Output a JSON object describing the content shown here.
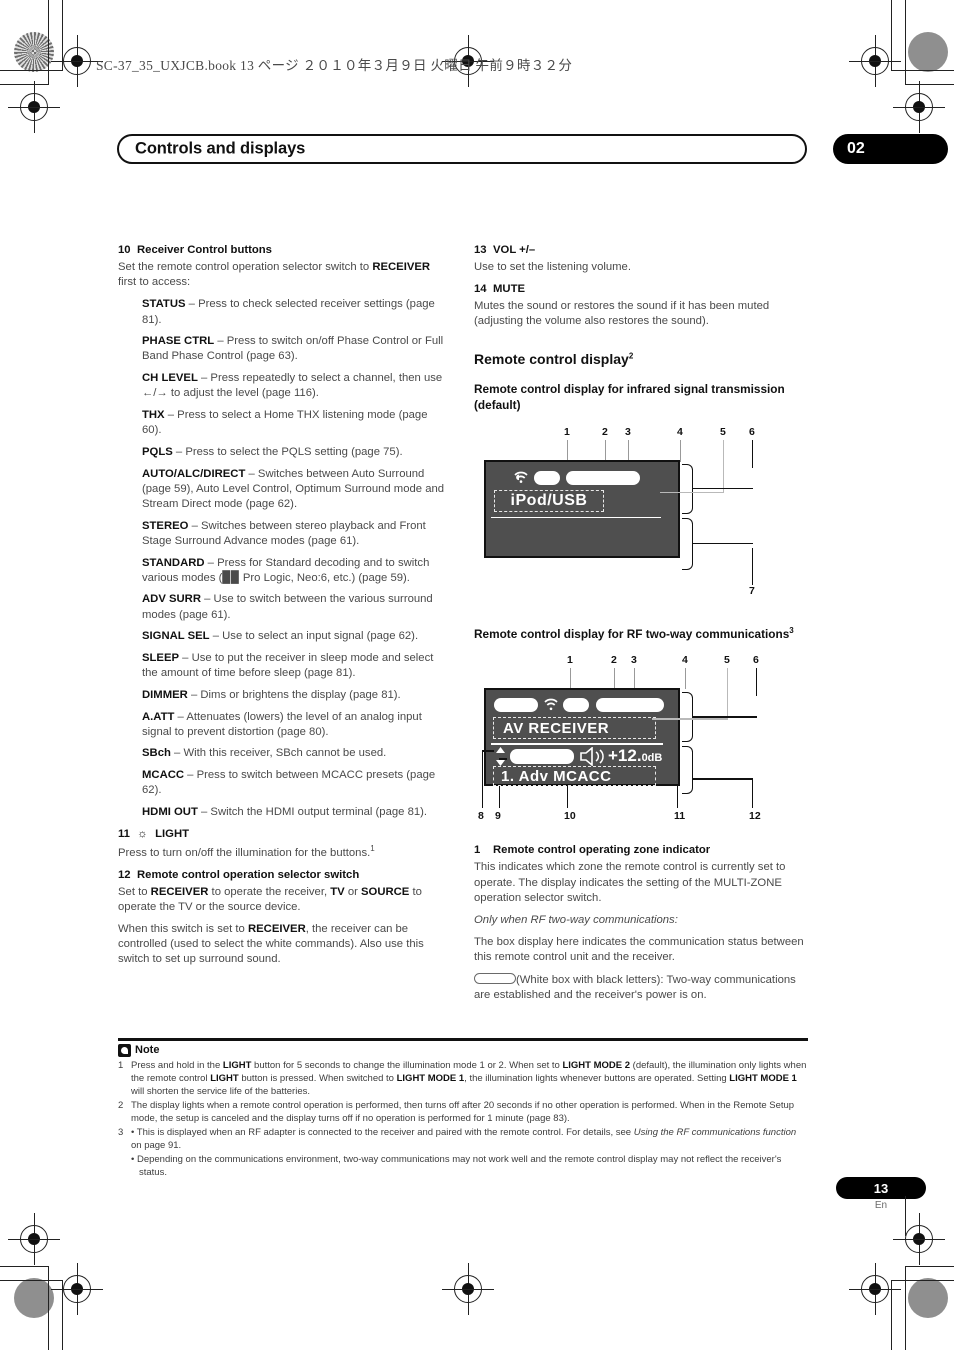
{
  "print": {
    "slug": "SC-37_35_UXJCB.book   13 ページ   ２０１０年３月９日   火曜日   午前９時３２分"
  },
  "header": {
    "chapter_title": "Controls and displays",
    "chapter_number": "02"
  },
  "left_column": {
    "section10": {
      "number": "10",
      "title": "Receiver Control buttons",
      "intro_1": "Set the remote control operation selector switch to ",
      "intro_bold": "RECEIVER",
      "intro_2": " first to access:",
      "items": [
        {
          "term": "STATUS",
          "desc": " – Press to check selected receiver settings (page 81)."
        },
        {
          "term": "PHASE CTRL",
          "desc": " – Press to switch on/off Phase Control or Full Band Phase Control (page 63)."
        },
        {
          "term": "CH LEVEL",
          "desc": " – Press repeatedly to select a channel, then use ←/→ to adjust the level (page 116)."
        },
        {
          "term": "THX",
          "desc": " – Press to select a Home THX listening mode (page 60)."
        },
        {
          "term": "PQLS",
          "desc": " – Press to select the PQLS setting (page 75)."
        },
        {
          "term": "AUTO/ALC/DIRECT",
          "desc": " – Switches between Auto Surround (page 59), Auto Level Control, Optimum Surround mode and Stream Direct mode (page 62)."
        },
        {
          "term": "STEREO",
          "desc": " – Switches between stereo playback and Front Stage Surround Advance modes (page 61)."
        },
        {
          "term": "STANDARD",
          "desc": " – Press for Standard decoding and to switch various modes (▉▉ Pro Logic, Neo:6, etc.) (page 59)."
        },
        {
          "term": "ADV SURR",
          "desc": " – Use to switch between the various surround modes (page 61)."
        },
        {
          "term": "SIGNAL SEL",
          "desc": " – Use to select an input signal (page 62)."
        },
        {
          "term": "SLEEP",
          "desc": " – Use to put the receiver in sleep mode and select the amount of time before sleep (page 81)."
        },
        {
          "term": "DIMMER",
          "desc": " – Dims or brightens the display (page 81)."
        },
        {
          "term": "A.ATT",
          "desc": " – Attenuates (lowers) the level of an analog input signal to prevent distortion (page 80)."
        },
        {
          "term": "SBch",
          "desc": " – With this receiver, SBch cannot be used."
        },
        {
          "term": "MCACC",
          "desc": " – Press to switch between MCACC presets (page 62)."
        },
        {
          "term": "HDMI OUT",
          "desc": " – Switch the HDMI output terminal (page 81)."
        }
      ]
    },
    "section11": {
      "number": "11",
      "icon": "sun-light-icon",
      "title": "LIGHT",
      "body": "Press to turn on/off the illumination for the buttons.",
      "footnote_ref": "1"
    },
    "section12": {
      "number": "12",
      "title": "Remote control operation selector switch",
      "para1_a": "Set to ",
      "para1_b": "RECEIVER",
      "para1_c": " to operate the receiver, ",
      "para1_d": "TV",
      "para1_e": " or ",
      "para1_f": "SOURCE",
      "para1_g": " to operate the TV or the source device.",
      "para2_a": "When this switch is set to ",
      "para2_b": "RECEIVER",
      "para2_c": ", the receiver can be controlled (used to select the white commands). Also use this switch to set up surround sound."
    }
  },
  "right_column": {
    "section13": {
      "number": "13",
      "title": "VOL +/–",
      "body": "Use to set the listening volume."
    },
    "section14": {
      "number": "14",
      "title": "MUTE",
      "body": "Mutes the sound or restores the sound if it has been muted (adjusting the volume also restores the sound)."
    },
    "display_heading": "Remote control display",
    "display_heading_ref": "2",
    "fig1": {
      "heading": "Remote control display for infrared signal transmission (default)",
      "callouts": [
        "1",
        "2",
        "3",
        "4",
        "5",
        "6",
        "7"
      ],
      "screen_text": "iPod/USB",
      "wifi_icon": "wifi-signal-icon"
    },
    "fig2": {
      "heading": "Remote control display for RF two-way communications",
      "heading_ref": "3",
      "callouts": [
        "1",
        "2",
        "3",
        "4",
        "5",
        "6",
        "8",
        "9",
        "10",
        "11",
        "12"
      ],
      "line1_text": "AV  RECEIVER",
      "volume_icon": "speaker-volume-icon",
      "volume_value": "+12.",
      "volume_unit": "0dB",
      "line2_text": "1. Adv MCACC",
      "updown_icon": "up-down-arrow-icon"
    },
    "item1": {
      "number": "1",
      "title": "Remote control operating zone indicator",
      "body": "This indicates which zone the remote control is currently set to operate. The display indicates the setting of the MULTI-ZONE operation selector switch.",
      "italic_line": "Only when RF two-way communications:",
      "body2": "The box display here indicates the communication status between this remote control unit and the receiver.",
      "box_legend_icon": "white-rounded-box-icon",
      "box_legend": "(White box with black letters): Two-way communications are established and the receiver's power is on."
    }
  },
  "notes": {
    "badge_icon": "note-icon",
    "title": "Note",
    "items": [
      {
        "parts": [
          {
            "t": "Press and hold in the ",
            "b": false
          },
          {
            "t": "LIGHT",
            "b": true
          },
          {
            "t": " button for 5 seconds to change the illumination mode 1 or 2. When set to ",
            "b": false
          },
          {
            "t": "LIGHT MODE 2",
            "b": true
          },
          {
            "t": " (default), the illumination only lights when the remote control ",
            "b": false
          },
          {
            "t": "LIGHT",
            "b": true
          },
          {
            "t": " button is pressed. When switched to ",
            "b": false
          },
          {
            "t": "LIGHT MODE 1",
            "b": true
          },
          {
            "t": ", the illumination lights whenever buttons are operated. Setting ",
            "b": false
          },
          {
            "t": "LIGHT MODE 1",
            "b": true
          },
          {
            "t": " will shorten the service life of the batteries.",
            "b": false
          }
        ]
      },
      {
        "parts": [
          {
            "t": "The display lights when a remote control operation is performed, then turns off after 20 seconds if no other operation is performed. When in the Remote Setup mode, the setup is canceled and the display turns off if no operation is performed for 1 minute (page 83).",
            "b": false
          }
        ]
      },
      {
        "parts": [
          {
            "t": "• This is displayed when an RF adapter is connected to the receiver and paired with the remote control. For details, see ",
            "b": false
          },
          {
            "t": "Using the RF communications function",
            "b": false,
            "i": true
          },
          {
            "t": " on page 91.",
            "b": false
          }
        ],
        "sub": "• Depending on the communications environment, two-way communications may not work well and the remote control display may not reflect the receiver's status."
      }
    ]
  },
  "footer": {
    "page_number": "13",
    "language": "En"
  }
}
